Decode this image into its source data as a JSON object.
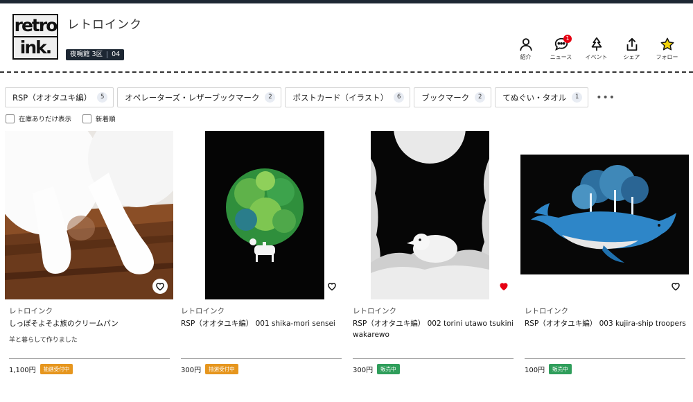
{
  "shop": {
    "logo_line1": "retro",
    "logo_line2": "ink.",
    "name": "レトロインク",
    "area": "夜鳴館 3区",
    "number": "04"
  },
  "actions": [
    {
      "label": "紹介",
      "icon": "person-icon"
    },
    {
      "label": "ニュース",
      "icon": "chat-bubble-icon",
      "badge": "1"
    },
    {
      "label": "イベント",
      "icon": "tree-icon"
    },
    {
      "label": "シェア",
      "icon": "share-icon"
    },
    {
      "label": "フォロー",
      "icon": "star-icon"
    }
  ],
  "tabs": [
    {
      "label": "RSP（オオタユキ編）",
      "count": "5"
    },
    {
      "label": "オペレーターズ・レザーブックマーク",
      "count": "2"
    },
    {
      "label": "ポストカード（イラスト）",
      "count": "6"
    },
    {
      "label": "ブックマーク",
      "count": "2"
    },
    {
      "label": "てぬぐい・タオル",
      "count": "1"
    }
  ],
  "more_label": "•••",
  "filters": {
    "in_stock": "在庫ありだけ表示",
    "newest": "新着順"
  },
  "products": [
    {
      "shop": "レトロインク",
      "title": "しっぽそよそよ族のクリームパン",
      "desc": "羊と暮らして作りました",
      "price": "1,100円",
      "status": "抽選受付中",
      "status_color": "#e6961e",
      "favorited": false
    },
    {
      "shop": "レトロインク",
      "title": "RSP（オオタユキ編） 001 shika-mori sensei",
      "desc": "",
      "price": "300円",
      "status": "抽選受付中",
      "status_color": "#e6961e",
      "favorited": false
    },
    {
      "shop": "レトロインク",
      "title": "RSP（オオタユキ編） 002 torini utawo tsukini wakarewo",
      "desc": "",
      "price": "300円",
      "status": "販売中",
      "status_color": "#2f9e5b",
      "favorited": true
    },
    {
      "shop": "レトロインク",
      "title": "RSP（オオタユキ編） 003 kujira-ship troopers",
      "desc": "",
      "price": "100円",
      "status": "販売中",
      "status_color": "#2f9e5b",
      "favorited": false
    }
  ]
}
